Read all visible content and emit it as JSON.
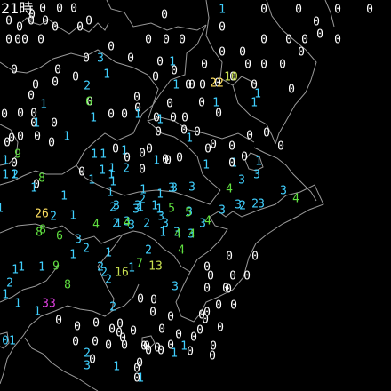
{
  "time_label": "21時",
  "colors": {
    "background": "#000000",
    "coastline": "#9a9a9a",
    "level_0": "#ffffff",
    "level_1_3": "#40d0ff",
    "level_4_9": "#60e040",
    "level_10_19": "#c8e050",
    "level_20_29": "#ffe060",
    "level_30_plus": "#e040e0"
  },
  "stations": [
    {
      "v": "0"
    },
    {
      "v": "0"
    },
    {
      "v": "0"
    },
    {
      "v": "0"
    },
    {
      "v": "0"
    },
    {
      "v": "0"
    },
    {
      "v": "0"
    },
    {
      "v": "0"
    },
    {
      "v": "0"
    },
    {
      "v": "0"
    },
    {
      "v": "0"
    },
    {
      "v": "0"
    },
    {
      "v": "0"
    },
    {
      "v": "0"
    },
    {
      "v": "0"
    },
    {
      "v": "0"
    },
    {
      "v": "1"
    },
    {
      "v": "0"
    },
    {
      "v": "0"
    },
    {
      "v": "0"
    },
    {
      "v": "0"
    },
    {
      "v": "0"
    },
    {
      "v": "0"
    },
    {
      "v": "0"
    },
    {
      "v": "0"
    },
    {
      "v": "0"
    },
    {
      "v": "0"
    },
    {
      "v": "0"
    },
    {
      "v": "0"
    },
    {
      "v": "0"
    },
    {
      "v": "0"
    },
    {
      "v": "0"
    },
    {
      "v": "0"
    },
    {
      "v": "0"
    },
    {
      "v": "0"
    },
    {
      "v": "0"
    },
    {
      "v": "0"
    },
    {
      "v": "3"
    },
    {
      "v": "0"
    },
    {
      "v": "0"
    },
    {
      "v": "1"
    },
    {
      "v": "0"
    },
    {
      "v": "0"
    },
    {
      "v": "0"
    },
    {
      "v": "0"
    },
    {
      "v": "0"
    },
    {
      "v": "0"
    },
    {
      "v": "0"
    },
    {
      "v": "0"
    },
    {
      "v": "0"
    },
    {
      "v": "0"
    },
    {
      "v": "0"
    },
    {
      "v": "1"
    },
    {
      "v": "0"
    },
    {
      "v": "0"
    },
    {
      "v": "0"
    },
    {
      "v": "0"
    },
    {
      "v": "0"
    },
    {
      "v": "0"
    },
    {
      "v": "22"
    },
    {
      "v": "10"
    },
    {
      "v": "0"
    },
    {
      "v": "2"
    },
    {
      "v": "1"
    },
    {
      "v": "0"
    },
    {
      "v": "1"
    },
    {
      "v": "1"
    },
    {
      "v": "0"
    },
    {
      "v": "0"
    },
    {
      "v": "0"
    },
    {
      "v": "0"
    },
    {
      "v": "6"
    },
    {
      "v": "0"
    },
    {
      "v": "0"
    },
    {
      "v": "0"
    },
    {
      "v": "1"
    },
    {
      "v": "0"
    },
    {
      "v": "1"
    },
    {
      "v": "0"
    },
    {
      "v": "0"
    },
    {
      "v": "1"
    },
    {
      "v": "0"
    },
    {
      "v": "1"
    },
    {
      "v": "0"
    },
    {
      "v": "0"
    },
    {
      "v": "1"
    },
    {
      "v": "0"
    },
    {
      "v": "1"
    },
    {
      "v": "0"
    },
    {
      "v": "1"
    },
    {
      "v": "0"
    },
    {
      "v": "0"
    },
    {
      "v": "0"
    },
    {
      "v": "0"
    },
    {
      "v": "0"
    },
    {
      "v": "0"
    },
    {
      "v": "0"
    },
    {
      "v": "0"
    },
    {
      "v": "0"
    },
    {
      "v": "1"
    },
    {
      "v": "0"
    },
    {
      "v": "0"
    },
    {
      "v": "0"
    },
    {
      "v": "0"
    },
    {
      "v": "0"
    },
    {
      "v": "0"
    },
    {
      "v": "1"
    },
    {
      "v": "0"
    },
    {
      "v": "0"
    },
    {
      "v": "0"
    },
    {
      "v": "0"
    },
    {
      "v": "1"
    },
    {
      "v": "0"
    },
    {
      "v": "1"
    },
    {
      "v": "9"
    },
    {
      "v": "1"
    },
    {
      "v": "1"
    },
    {
      "v": "1"
    },
    {
      "v": "0"
    },
    {
      "v": "0"
    },
    {
      "v": "0"
    },
    {
      "v": "1"
    },
    {
      "v": "0"
    },
    {
      "v": "1"
    },
    {
      "v": "1"
    },
    {
      "v": "2"
    },
    {
      "v": "1"
    },
    {
      "v": "1"
    },
    {
      "v": "1"
    },
    {
      "v": "0"
    },
    {
      "v": "1"
    },
    {
      "v": "1"
    },
    {
      "v": "0"
    },
    {
      "v": "3"
    },
    {
      "v": "1"
    },
    {
      "v": "8"
    },
    {
      "v": "2"
    },
    {
      "v": "1"
    },
    {
      "v": "1"
    },
    {
      "v": "3"
    },
    {
      "v": "3"
    },
    {
      "v": "4"
    },
    {
      "v": "3"
    },
    {
      "v": "3"
    },
    {
      "v": "1"
    },
    {
      "v": "4"
    },
    {
      "v": "2"
    },
    {
      "v": "1"
    },
    {
      "v": "1"
    },
    {
      "v": "0"
    },
    {
      "v": "1"
    },
    {
      "v": "1"
    },
    {
      "v": "3"
    },
    {
      "v": "1"
    },
    {
      "v": "2"
    },
    {
      "v": "3"
    },
    {
      "v": "1"
    },
    {
      "v": "5"
    },
    {
      "v": "3"
    },
    {
      "v": "3"
    },
    {
      "v": "3"
    },
    {
      "v": "2"
    },
    {
      "v": "26"
    },
    {
      "v": "2"
    },
    {
      "v": "1"
    },
    {
      "v": "3"
    },
    {
      "v": "3"
    },
    {
      "v": "3"
    },
    {
      "v": "3"
    },
    {
      "v": "5"
    },
    {
      "v": "3"
    },
    {
      "v": "3"
    },
    {
      "v": "3"
    },
    {
      "v": "2"
    },
    {
      "v": "8"
    },
    {
      "v": "4"
    },
    {
      "v": "2"
    },
    {
      "v": "4"
    },
    {
      "v": "2"
    },
    {
      "v": "3"
    },
    {
      "v": "3"
    },
    {
      "v": "4"
    },
    {
      "v": "1"
    },
    {
      "v": "8"
    },
    {
      "v": "6"
    },
    {
      "v": "3"
    },
    {
      "v": "4"
    },
    {
      "v": "4"
    },
    {
      "v": "2"
    },
    {
      "v": "3"
    },
    {
      "v": "1"
    },
    {
      "v": "1"
    },
    {
      "v": "4"
    },
    {
      "v": "2"
    },
    {
      "v": "1"
    },
    {
      "v": "1"
    },
    {
      "v": "2"
    },
    {
      "v": "1"
    },
    {
      "v": "9"
    },
    {
      "v": "1"
    },
    {
      "v": "7"
    },
    {
      "v": "13"
    },
    {
      "v": "0"
    },
    {
      "v": "0"
    },
    {
      "v": "0"
    },
    {
      "v": "2"
    },
    {
      "v": "1"
    },
    {
      "v": "16"
    },
    {
      "v": "2"
    },
    {
      "v": "0"
    },
    {
      "v": "0"
    },
    {
      "v": "0"
    },
    {
      "v": "2"
    },
    {
      "v": "8"
    },
    {
      "v": "3"
    },
    {
      "v": "0"
    },
    {
      "v": "1"
    },
    {
      "v": "1"
    },
    {
      "v": "33"
    },
    {
      "v": "2"
    },
    {
      "v": "0"
    },
    {
      "v": "0"
    },
    {
      "v": "0"
    },
    {
      "v": "0"
    },
    {
      "v": "0"
    },
    {
      "v": "1"
    },
    {
      "v": "0"
    },
    {
      "v": "0"
    },
    {
      "v": "0"
    },
    {
      "v": "0"
    },
    {
      "v": "01"
    },
    {
      "v": "0"
    },
    {
      "v": "0"
    },
    {
      "v": "0"
    },
    {
      "v": "0"
    },
    {
      "v": "3"
    },
    {
      "v": "0"
    },
    {
      "v": "0"
    },
    {
      "v": "0"
    },
    {
      "v": "0"
    },
    {
      "v": "0"
    },
    {
      "v": "0"
    },
    {
      "v": "0"
    },
    {
      "v": "0"
    },
    {
      "v": "0"
    },
    {
      "v": "0"
    },
    {
      "v": "0"
    },
    {
      "v": "0"
    },
    {
      "v": "0"
    },
    {
      "v": "0"
    },
    {
      "v": "0"
    },
    {
      "v": "1"
    },
    {
      "v": "0"
    },
    {
      "v": "0"
    },
    {
      "v": "1"
    },
    {
      "v": "0"
    },
    {
      "v": "0"
    },
    {
      "v": "0"
    },
    {
      "v": "0"
    },
    {
      "v": "0"
    },
    {
      "v": "0"
    },
    {
      "v": "0"
    },
    {
      "v": "0"
    },
    {
      "v": "0"
    },
    {
      "v": "0"
    },
    {
      "v": "0"
    },
    {
      "v": "1"
    },
    {
      "v": "1"
    },
    {
      "v": "2"
    }
  ]
}
